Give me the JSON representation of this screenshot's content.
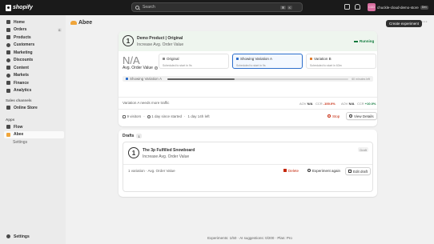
{
  "topbar": {
    "logo": "shopify",
    "search_placeholder": "Search",
    "shortcut": [
      "⌘",
      "K"
    ],
    "store": {
      "initials": "CCD",
      "name": "chuckle-cloud-demo-store",
      "badge": "Dev"
    }
  },
  "sidebar": {
    "items": [
      {
        "label": "Home",
        "icon": "home-icon"
      },
      {
        "label": "Orders",
        "icon": "orders-icon",
        "count": "6"
      },
      {
        "label": "Products",
        "icon": "products-icon"
      },
      {
        "label": "Customers",
        "icon": "customers-icon"
      },
      {
        "label": "Marketing",
        "icon": "marketing-icon"
      },
      {
        "label": "Discounts",
        "icon": "discounts-icon"
      },
      {
        "label": "Content",
        "icon": "content-icon"
      },
      {
        "label": "Markets",
        "icon": "markets-icon"
      },
      {
        "label": "Finance",
        "icon": "finance-icon"
      },
      {
        "label": "Analytics",
        "icon": "analytics-icon"
      }
    ],
    "sales_channels_heading": "Sales channels",
    "online_store": "Online Store",
    "apps_heading": "Apps",
    "apps": [
      {
        "label": "Flow",
        "icon": "flow-icon"
      },
      {
        "label": "Abee",
        "icon": "abee-icon"
      }
    ],
    "app_sub": "Settings",
    "settings": "Settings"
  },
  "page": {
    "title": "Abee",
    "create_button": "Create experiment",
    "more": "···"
  },
  "experiment": {
    "step": "1",
    "title": "Demo Product | Original",
    "goal": "Increase Avg. Order Value",
    "status": "Running",
    "metric_value": "N/A",
    "metric_label": "Avg. Order Value",
    "variations": [
      {
        "name": "Original",
        "note": "Scheduled to start in 9s",
        "color": "#8a8a8a"
      },
      {
        "name": "Showing Variation A",
        "note": "Scheduled to start in 9s",
        "color": "#2c6ecb"
      },
      {
        "name": "Variation B",
        "note": "Scheduled to start in 63m",
        "color": "#e07b2a"
      }
    ],
    "progress_label": "Showing Variation A",
    "progress_fraction": 0.37,
    "progress_remaining": "60 minutes left",
    "more_traffic": "Variation A needs more traffic",
    "metrics": [
      {
        "label": "AOV",
        "value": "N/A"
      },
      {
        "label": "CCR",
        "value": "-100.0%",
        "kind": "neg"
      },
      {
        "label": "AOV",
        "value": "N/A"
      },
      {
        "label": "CCR",
        "value": "+10.0%",
        "kind": "pos"
      }
    ],
    "stats": {
      "visitors": "9 visitors",
      "since": "1 day since started",
      "left": "1 day 14h left"
    },
    "stop_button": "Stop",
    "details_button": "View Details"
  },
  "drafts": {
    "title": "Drafts",
    "count": "1",
    "item": {
      "step": "1",
      "name": "The 3p Fulfilled Snowboard",
      "goal": "Increase Avg. Order Value",
      "badge": "Draft",
      "meta": "1 variation · Avg. Order Value",
      "delete_button": "Delete",
      "again_button": "Experiment again",
      "edit_button": "Edit draft"
    }
  },
  "footer": "Experiments: 1/50 · AI suggestions: 0/200 · Plan: Pro",
  "colors": {
    "running": "#117a3d",
    "selected": "#2c6ecb",
    "danger": "#c5280c"
  }
}
